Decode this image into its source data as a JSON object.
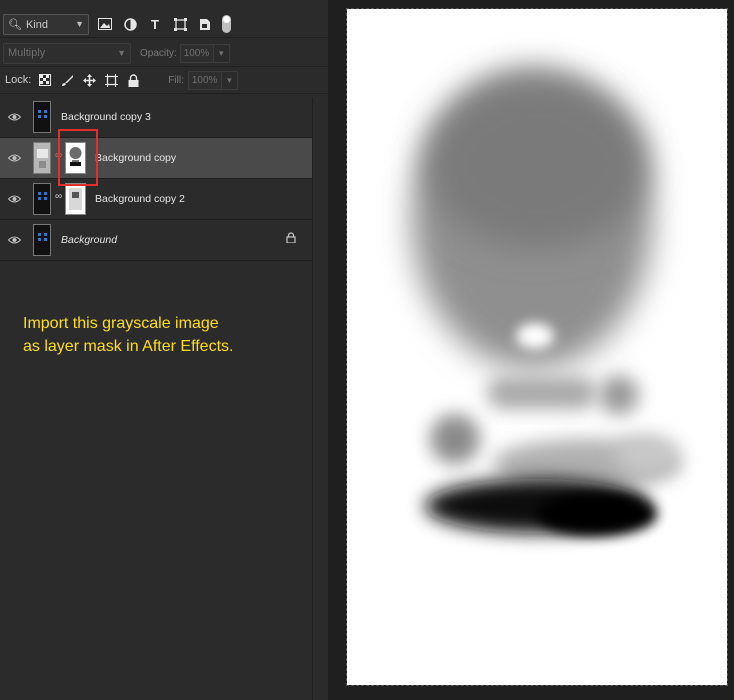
{
  "toolbar": {
    "kind_label": "Kind",
    "filter_icons": [
      "image-filter-icon",
      "adjustment-filter-icon",
      "type-filter-icon",
      "shape-filter-icon",
      "smart-object-filter-icon"
    ],
    "blend_mode": "Multiply",
    "opacity_label": "Opacity:",
    "opacity_value": "100%",
    "lock_label": "Lock:",
    "fill_label": "Fill:",
    "fill_value": "100%"
  },
  "layers": [
    {
      "name": "Background copy 3",
      "selected": false,
      "has_mask": false,
      "italic": false
    },
    {
      "name": "Background copy",
      "selected": true,
      "has_mask": true,
      "italic": false
    },
    {
      "name": "Background copy 2",
      "selected": false,
      "has_mask": true,
      "italic": false
    },
    {
      "name": "Background",
      "selected": false,
      "has_mask": false,
      "italic": true,
      "locked": true
    }
  ],
  "annotation": {
    "line1": "Import this grayscale image",
    "line2": "as layer mask in After Effects.",
    "color": "#ffde18"
  },
  "colors": {
    "panel_bg": "#2b2b2b",
    "selected_row": "#4a4a4a",
    "highlight": "#e0312f"
  }
}
